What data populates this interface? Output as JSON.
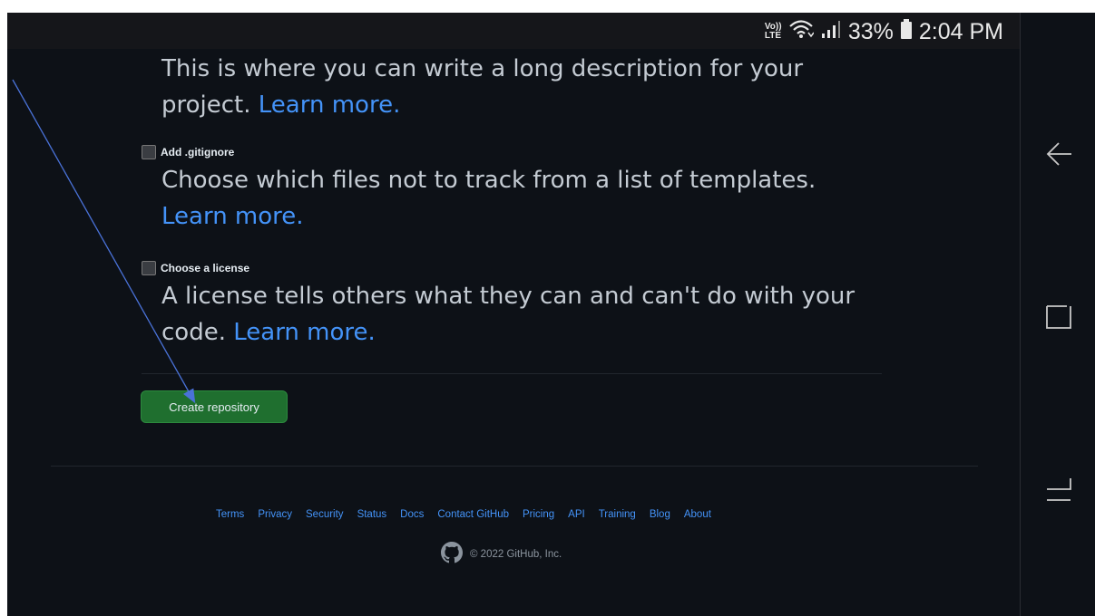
{
  "status_bar": {
    "volte_line1": "Vo))",
    "volte_line2": "LTE",
    "battery": "33%",
    "time": "2:04 PM"
  },
  "readme": {
    "text": "This is where you can write a long description for your project.",
    "link": "Learn more."
  },
  "gitignore": {
    "label": "Add .gitignore",
    "text": "Choose which files not to track from a list of templates.",
    "link": "Learn more."
  },
  "license": {
    "label": "Choose a license",
    "text": "A license tells others what they can and can't do with your code.",
    "link": "Learn more."
  },
  "create_button": "Create repository",
  "footer": {
    "links": [
      "Terms",
      "Privacy",
      "Security",
      "Status",
      "Docs",
      "Contact GitHub",
      "Pricing",
      "API",
      "Training",
      "Blog",
      "About"
    ],
    "copyright": "© 2022 GitHub, Inc."
  },
  "colors": {
    "background": "#0d1117",
    "link": "#4493f8",
    "button": "#1f6f2f",
    "annotation_arrow": "#4a72d8"
  },
  "icons": [
    "github-logo-icon",
    "wifi-icon",
    "signal-icon",
    "battery-icon",
    "back-icon",
    "recents-icon",
    "overview-icon"
  ]
}
